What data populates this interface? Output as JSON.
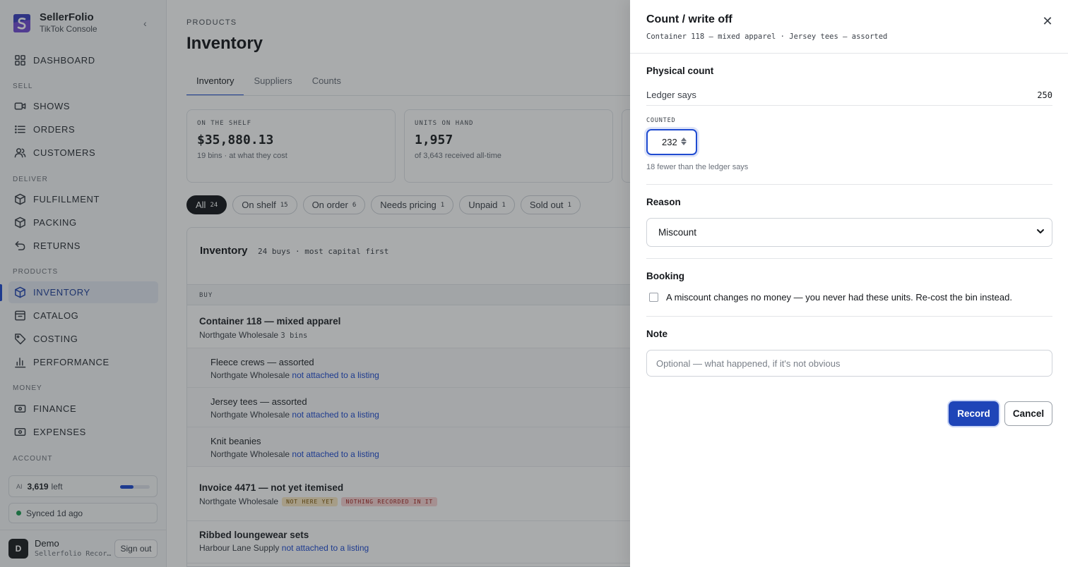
{
  "sidebar": {
    "brand_name": "SellerFolio",
    "brand_sub": "TikTok Console",
    "sections": {
      "sell": "SELL",
      "deliver": "DELIVER",
      "products": "PRODUCTS",
      "money": "MONEY",
      "account": "ACCOUNT"
    },
    "items": {
      "dashboard": "DASHBOARD",
      "shows": "SHOWS",
      "orders": "ORDERS",
      "customers": "CUSTOMERS",
      "fulfillment": "FULFILLMENT",
      "packing": "PACKING",
      "returns": "RETURNS",
      "inventory": "INVENTORY",
      "catalog": "CATALOG",
      "costing": "COSTING",
      "performance": "PERFORMANCE",
      "finance": "FINANCE",
      "expenses": "EXPENSES"
    },
    "ai": {
      "tag": "AI",
      "value": "3,619",
      "suffix": "left",
      "usage_fraction": 0.45
    },
    "sync": "Synced 1d ago",
    "user": {
      "initial": "D",
      "name": "Demo",
      "sub": "Sellerfolio Recor…",
      "signout": "Sign out"
    }
  },
  "main": {
    "crumb": "PRODUCTS",
    "title": "Inventory",
    "tabs": [
      "Inventory",
      "Suppliers",
      "Counts"
    ],
    "stats": [
      {
        "label": "ON THE SHELF",
        "value": "$35,880.13",
        "sub": "19 bins · at what they cost"
      },
      {
        "label": "UNITS ON HAND",
        "value": "1,957",
        "sub": "of 3,643 received all-time"
      }
    ],
    "chips": [
      {
        "label": "All",
        "count": "24"
      },
      {
        "label": "On shelf",
        "count": "15"
      },
      {
        "label": "On order",
        "count": "6"
      },
      {
        "label": "Needs pricing",
        "count": "1"
      },
      {
        "label": "Unpaid",
        "count": "1"
      },
      {
        "label": "Sold out",
        "count": "1"
      }
    ],
    "panel": {
      "title": "Inventory",
      "sub": "24 buys · most capital first",
      "col_buy": "BUY",
      "rows": [
        {
          "title": "Container 118 — mixed apparel",
          "supplier": "Northgate Wholesale",
          "meta": "3 bins"
        },
        {
          "title": "Fleece crews — assorted",
          "supplier": "Northgate Wholesale",
          "link": "not attached to a listing"
        },
        {
          "title": "Jersey tees — assorted",
          "supplier": "Northgate Wholesale",
          "link": "not attached to a listing"
        },
        {
          "title": "Knit beanies",
          "supplier": "Northgate Wholesale",
          "link": "not attached to a listing"
        },
        {
          "title": "Invoice 4471 — not yet itemised",
          "supplier": "Northgate Wholesale",
          "badge1": "NOT HERE YET",
          "badge2": "NOTHING RECORDED IN IT"
        },
        {
          "title": "Ribbed loungewear sets",
          "supplier": "Harbour Lane Supply",
          "link": "not attached to a listing"
        }
      ]
    }
  },
  "drawer": {
    "title": "Count / write off",
    "subtitle": "Container 118 — mixed apparel · Jersey tees — assorted",
    "physical_heading": "Physical count",
    "ledger_label": "Ledger says",
    "ledger_value": "250",
    "counted_label": "COUNTED",
    "counted_value": "232",
    "difference_note": "18 fewer than the ledger says",
    "reason_heading": "Reason",
    "reason_value": "Miscount",
    "booking_heading": "Booking",
    "booking_text": "A miscount changes no money — you never had these units. Re-cost the bin instead.",
    "note_heading": "Note",
    "note_placeholder": "Optional — what happened, if it's not obvious",
    "record_label": "Record",
    "cancel_label": "Cancel"
  }
}
